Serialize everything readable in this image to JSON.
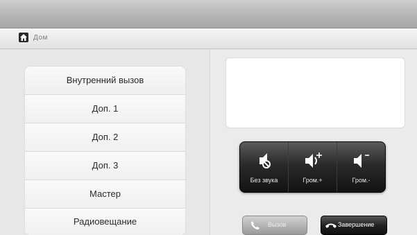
{
  "breadcrumb": {
    "label": "Дом"
  },
  "menu": {
    "items": [
      {
        "label": "Внутренний вызов"
      },
      {
        "label": "Доп. 1"
      },
      {
        "label": "Доп. 2"
      },
      {
        "label": "Доп. 3"
      },
      {
        "label": "Мастер"
      },
      {
        "label": "Радиовещание"
      }
    ]
  },
  "audio": {
    "mute_label": "Без звука",
    "vol_up_label": "Гром.+",
    "vol_down_label": "Гром.-"
  },
  "actions": {
    "call_label": "Вызов",
    "end_label": "Завершение"
  },
  "colors": {
    "topbar": "#b3b3b3",
    "panel_dark": "#2a2a2a",
    "menu_bg": "#ffffff"
  }
}
